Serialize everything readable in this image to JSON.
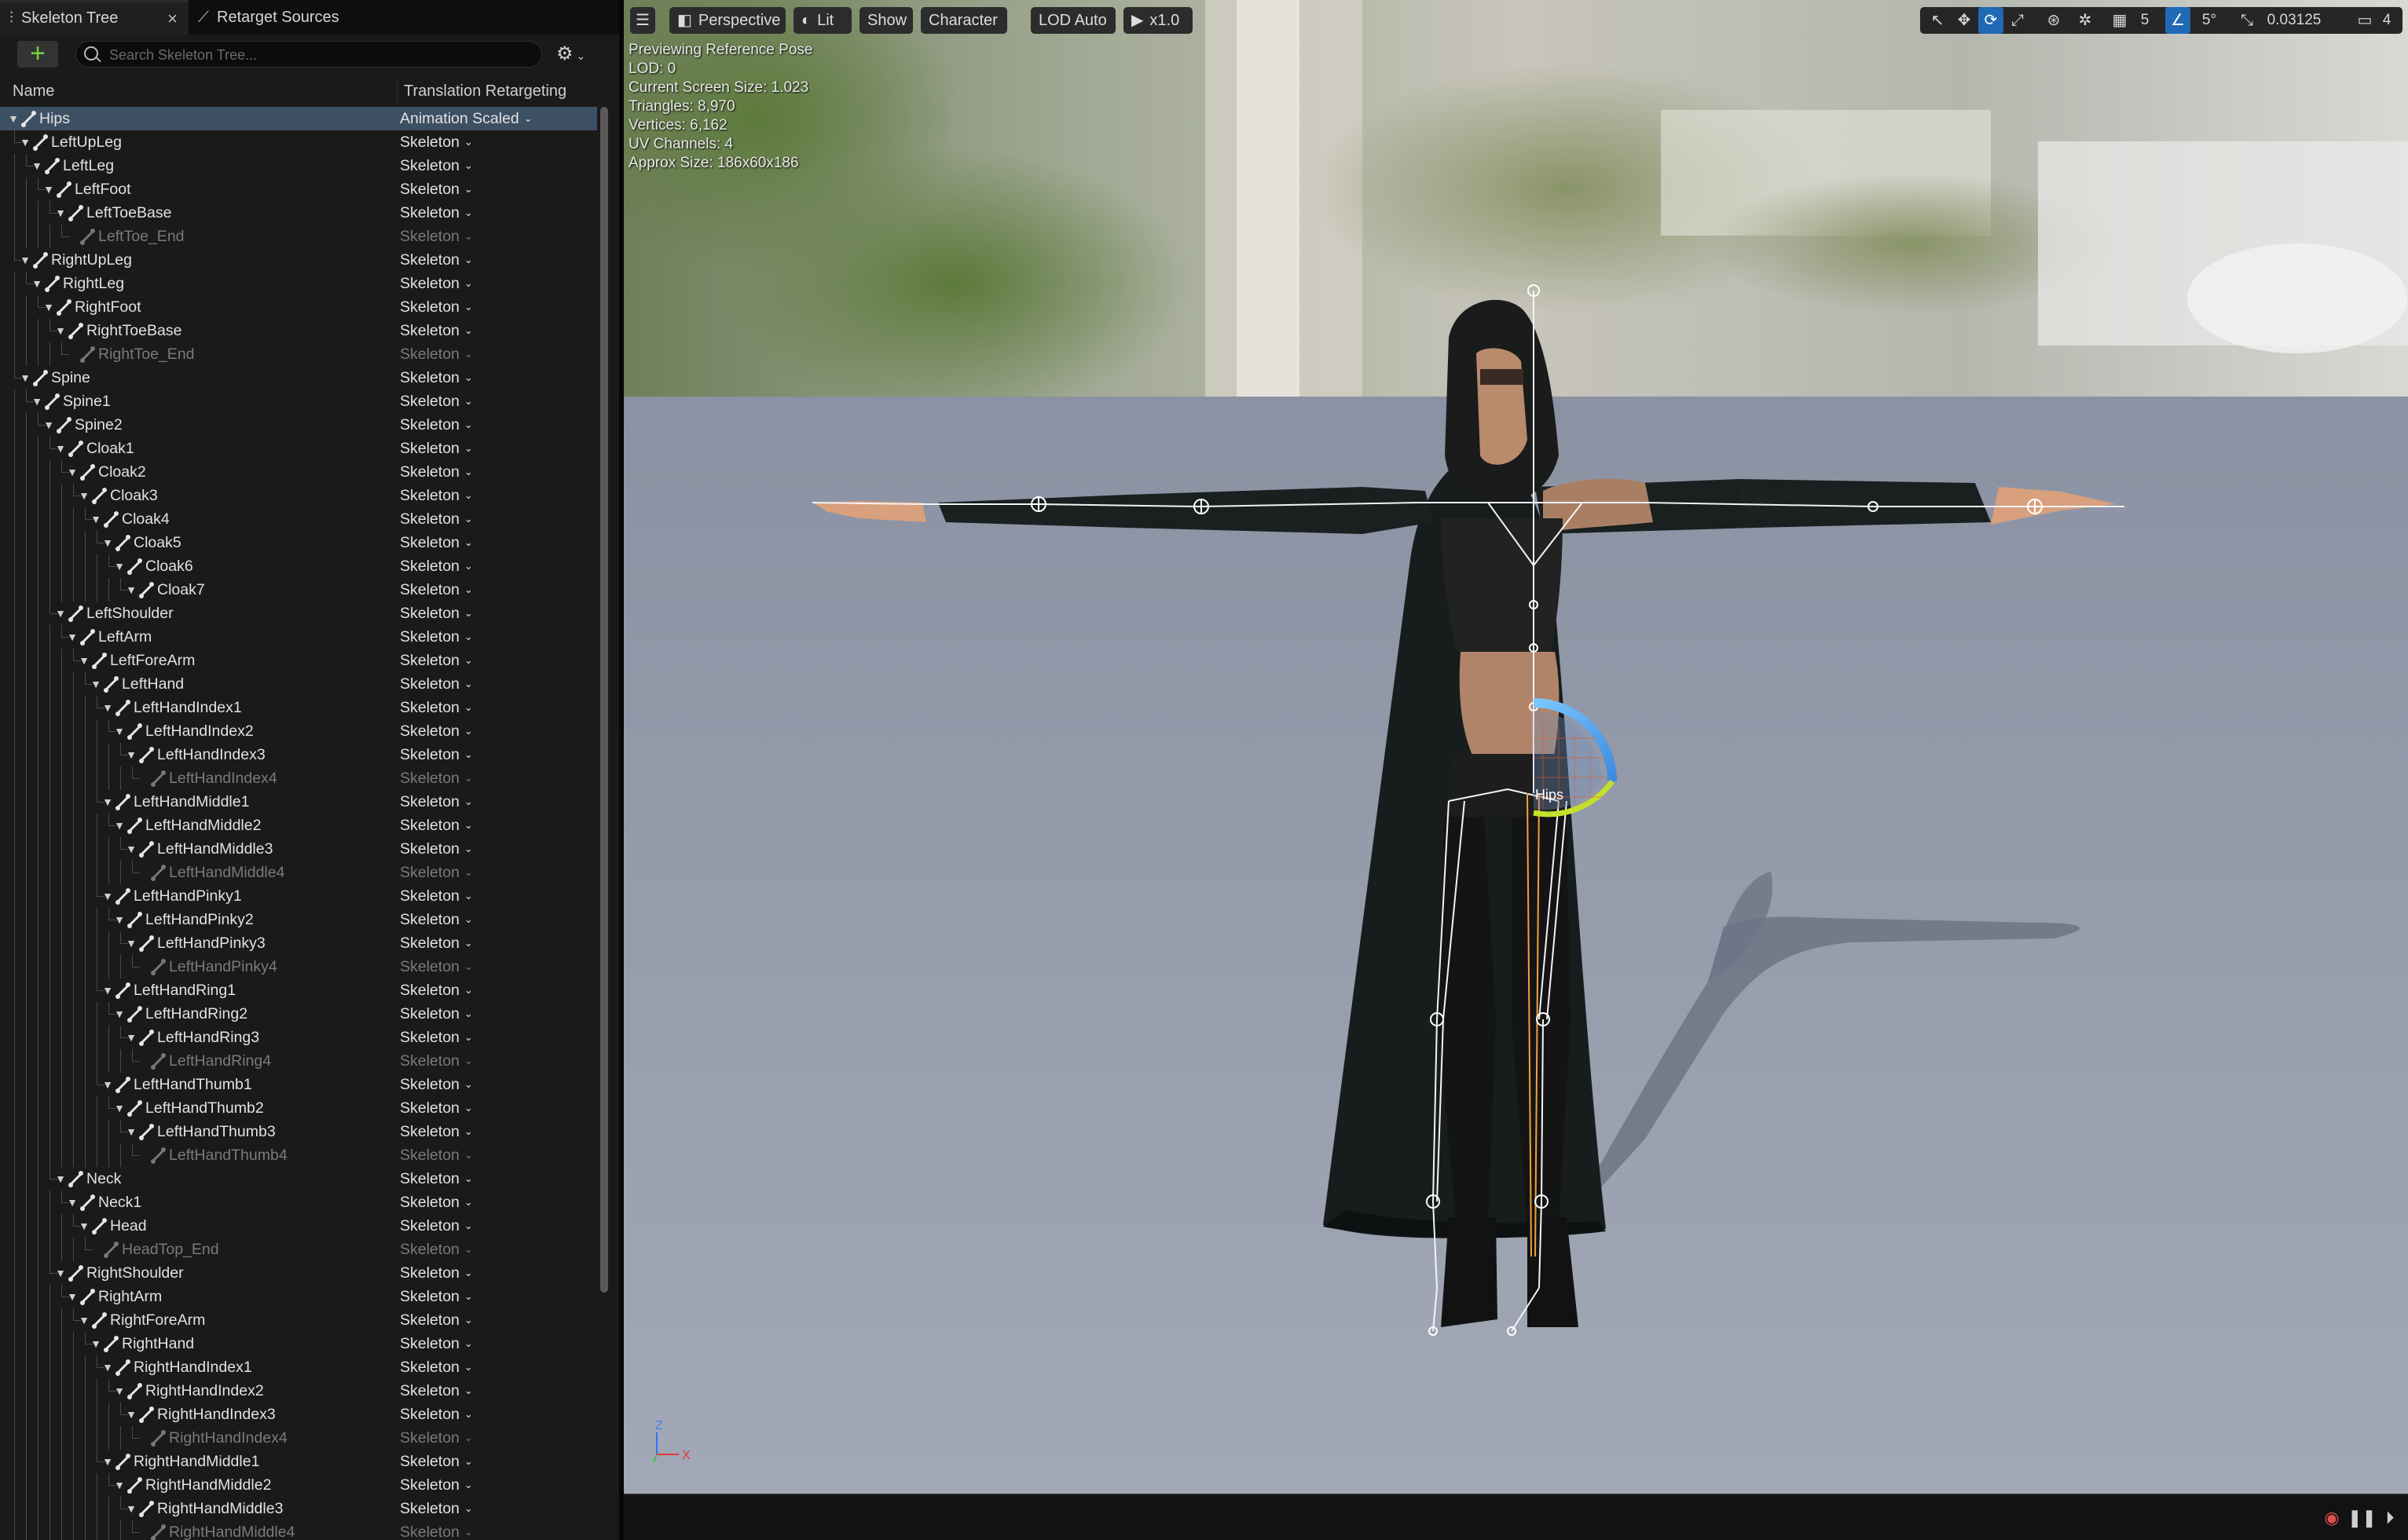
{
  "tabs": [
    {
      "label": "Skeleton Tree",
      "icon": "skeleton-tree-icon",
      "active": true
    },
    {
      "label": "Retarget Sources",
      "icon": "bone-icon",
      "active": false
    }
  ],
  "search": {
    "placeholder": "Search Skeleton Tree..."
  },
  "columns": {
    "name": "Name",
    "translation": "Translation Retargeting"
  },
  "bones": [
    {
      "name": "Hips",
      "depth": 0,
      "mode": "Animation Scaled",
      "selected": true
    },
    {
      "name": "LeftUpLeg",
      "depth": 1,
      "mode": "Skeleton"
    },
    {
      "name": "LeftLeg",
      "depth": 2,
      "mode": "Skeleton"
    },
    {
      "name": "LeftFoot",
      "depth": 3,
      "mode": "Skeleton"
    },
    {
      "name": "LeftToeBase",
      "depth": 4,
      "mode": "Skeleton"
    },
    {
      "name": "LeftToe_End",
      "depth": 5,
      "mode": "Skeleton",
      "leaf": true
    },
    {
      "name": "RightUpLeg",
      "depth": 1,
      "mode": "Skeleton"
    },
    {
      "name": "RightLeg",
      "depth": 2,
      "mode": "Skeleton"
    },
    {
      "name": "RightFoot",
      "depth": 3,
      "mode": "Skeleton"
    },
    {
      "name": "RightToeBase",
      "depth": 4,
      "mode": "Skeleton"
    },
    {
      "name": "RightToe_End",
      "depth": 5,
      "mode": "Skeleton",
      "leaf": true
    },
    {
      "name": "Spine",
      "depth": 1,
      "mode": "Skeleton"
    },
    {
      "name": "Spine1",
      "depth": 2,
      "mode": "Skeleton"
    },
    {
      "name": "Spine2",
      "depth": 3,
      "mode": "Skeleton"
    },
    {
      "name": "Cloak1",
      "depth": 4,
      "mode": "Skeleton"
    },
    {
      "name": "Cloak2",
      "depth": 5,
      "mode": "Skeleton"
    },
    {
      "name": "Cloak3",
      "depth": 6,
      "mode": "Skeleton"
    },
    {
      "name": "Cloak4",
      "depth": 7,
      "mode": "Skeleton"
    },
    {
      "name": "Cloak5",
      "depth": 8,
      "mode": "Skeleton"
    },
    {
      "name": "Cloak6",
      "depth": 9,
      "mode": "Skeleton"
    },
    {
      "name": "Cloak7",
      "depth": 10,
      "mode": "Skeleton"
    },
    {
      "name": "LeftShoulder",
      "depth": 4,
      "mode": "Skeleton"
    },
    {
      "name": "LeftArm",
      "depth": 5,
      "mode": "Skeleton"
    },
    {
      "name": "LeftForeArm",
      "depth": 6,
      "mode": "Skeleton"
    },
    {
      "name": "LeftHand",
      "depth": 7,
      "mode": "Skeleton"
    },
    {
      "name": "LeftHandIndex1",
      "depth": 8,
      "mode": "Skeleton"
    },
    {
      "name": "LeftHandIndex2",
      "depth": 9,
      "mode": "Skeleton"
    },
    {
      "name": "LeftHandIndex3",
      "depth": 10,
      "mode": "Skeleton"
    },
    {
      "name": "LeftHandIndex4",
      "depth": 11,
      "mode": "Skeleton",
      "leaf": true
    },
    {
      "name": "LeftHandMiddle1",
      "depth": 8,
      "mode": "Skeleton"
    },
    {
      "name": "LeftHandMiddle2",
      "depth": 9,
      "mode": "Skeleton"
    },
    {
      "name": "LeftHandMiddle3",
      "depth": 10,
      "mode": "Skeleton"
    },
    {
      "name": "LeftHandMiddle4",
      "depth": 11,
      "mode": "Skeleton",
      "leaf": true
    },
    {
      "name": "LeftHandPinky1",
      "depth": 8,
      "mode": "Skeleton"
    },
    {
      "name": "LeftHandPinky2",
      "depth": 9,
      "mode": "Skeleton"
    },
    {
      "name": "LeftHandPinky3",
      "depth": 10,
      "mode": "Skeleton"
    },
    {
      "name": "LeftHandPinky4",
      "depth": 11,
      "mode": "Skeleton",
      "leaf": true
    },
    {
      "name": "LeftHandRing1",
      "depth": 8,
      "mode": "Skeleton"
    },
    {
      "name": "LeftHandRing2",
      "depth": 9,
      "mode": "Skeleton"
    },
    {
      "name": "LeftHandRing3",
      "depth": 10,
      "mode": "Skeleton"
    },
    {
      "name": "LeftHandRing4",
      "depth": 11,
      "mode": "Skeleton",
      "leaf": true
    },
    {
      "name": "LeftHandThumb1",
      "depth": 8,
      "mode": "Skeleton"
    },
    {
      "name": "LeftHandThumb2",
      "depth": 9,
      "mode": "Skeleton"
    },
    {
      "name": "LeftHandThumb3",
      "depth": 10,
      "mode": "Skeleton"
    },
    {
      "name": "LeftHandThumb4",
      "depth": 11,
      "mode": "Skeleton",
      "leaf": true
    },
    {
      "name": "Neck",
      "depth": 4,
      "mode": "Skeleton"
    },
    {
      "name": "Neck1",
      "depth": 5,
      "mode": "Skeleton"
    },
    {
      "name": "Head",
      "depth": 6,
      "mode": "Skeleton"
    },
    {
      "name": "HeadTop_End",
      "depth": 7,
      "mode": "Skeleton",
      "leaf": true
    },
    {
      "name": "RightShoulder",
      "depth": 4,
      "mode": "Skeleton"
    },
    {
      "name": "RightArm",
      "depth": 5,
      "mode": "Skeleton"
    },
    {
      "name": "RightForeArm",
      "depth": 6,
      "mode": "Skeleton"
    },
    {
      "name": "RightHand",
      "depth": 7,
      "mode": "Skeleton"
    },
    {
      "name": "RightHandIndex1",
      "depth": 8,
      "mode": "Skeleton"
    },
    {
      "name": "RightHandIndex2",
      "depth": 9,
      "mode": "Skeleton"
    },
    {
      "name": "RightHandIndex3",
      "depth": 10,
      "mode": "Skeleton"
    },
    {
      "name": "RightHandIndex4",
      "depth": 11,
      "mode": "Skeleton",
      "leaf": true
    },
    {
      "name": "RightHandMiddle1",
      "depth": 8,
      "mode": "Skeleton"
    },
    {
      "name": "RightHandMiddle2",
      "depth": 9,
      "mode": "Skeleton"
    },
    {
      "name": "RightHandMiddle3",
      "depth": 10,
      "mode": "Skeleton"
    },
    {
      "name": "RightHandMiddle4",
      "depth": 11,
      "mode": "Skeleton",
      "leaf": true
    }
  ],
  "viewport": {
    "menu_icon": "hamburger-menu-icon",
    "perspective_label": "Perspective",
    "lit_label": "Lit",
    "show_label": "Show",
    "character_label": "Character",
    "lod_label": "LOD Auto",
    "speed_label": "x1.0",
    "grid_snap_value": "5",
    "rotation_snap_value": "5°",
    "scale_snap_value": "0.03125",
    "camera_speed_value": "4",
    "stats": [
      "Previewing Reference Pose",
      "LOD: 0",
      "Current Screen Size: 1.023",
      "Triangles: 8,970",
      "Vertices: 6,162",
      "UV Channels: 4",
      "Approx Size: 186x60x186"
    ],
    "bone_gizmo_label": "Hips",
    "axis": {
      "z": "Z",
      "x": "X"
    },
    "colors": {
      "accent_blue": "#2069b5",
      "floor": "#8e96a6",
      "add_green": "#6fd43c"
    }
  }
}
